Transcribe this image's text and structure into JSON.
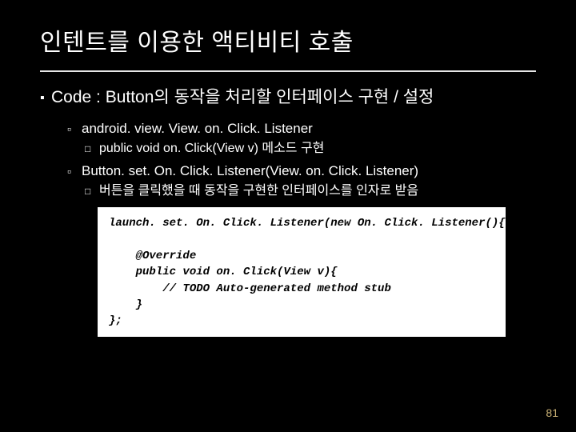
{
  "title": "인텐트를 이용한 액티비티 호출",
  "bullets": {
    "lvl1_text": "Code : Button의 동작을 처리할 인터페이스 구현 / 설정",
    "item1_lvl2": "android. view. View. on. Click. Listener",
    "item1_lvl3": "public void on. Click(View v) 메소드 구현",
    "item2_lvl2": "Button. set. On. Click. Listener(View. on. Click. Listener)",
    "item2_lvl3": "버튼을 클릭했을 때 동작을 구현한 인터페이스를 인자로 받음"
  },
  "code": "launch. set. On. Click. Listener(new On. Click. Listener(){\n\n    @Override\n    public void on. Click(View v){\n        // TODO Auto-generated method stub\n    }\n};",
  "glyphs": {
    "square_filled": "▪",
    "square_open": "▫",
    "square_box": "□"
  },
  "page_number": "81"
}
